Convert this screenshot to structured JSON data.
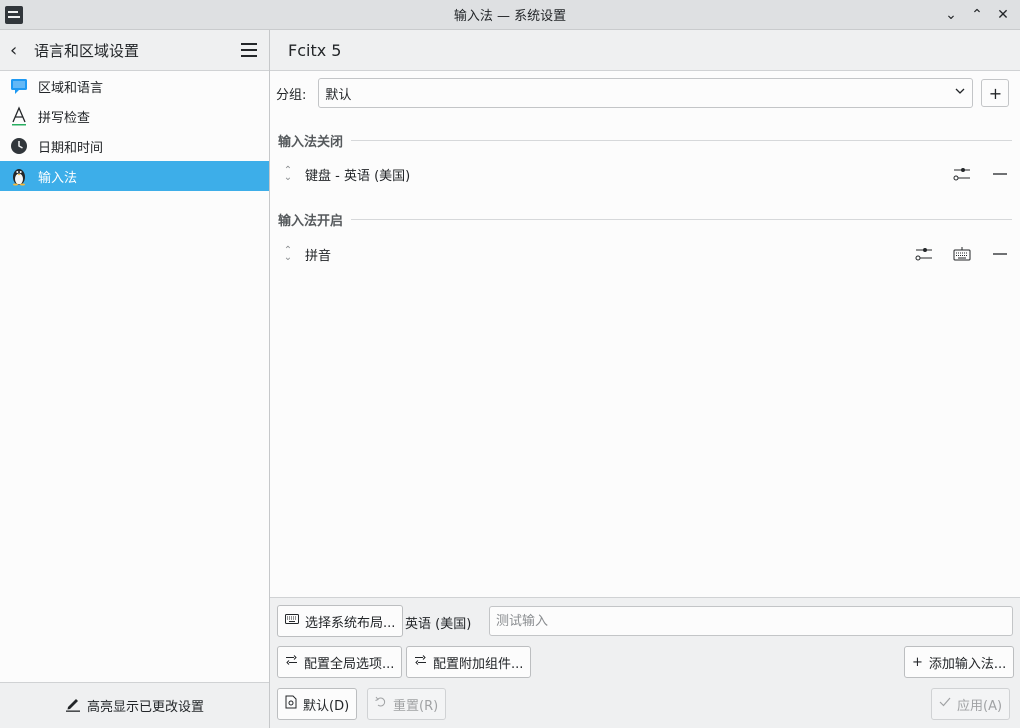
{
  "window": {
    "title": "输入法 — 系统设置"
  },
  "sidebar": {
    "title": "语言和区域设置",
    "items": [
      {
        "label": "区域和语言",
        "icon": "speech-bubble-icon"
      },
      {
        "label": "拼写检查",
        "icon": "letter-a-icon"
      },
      {
        "label": "日期和时间",
        "icon": "clock-icon"
      },
      {
        "label": "输入法",
        "icon": "penguin-icon"
      }
    ],
    "footer_label": "高亮显示已更改设置"
  },
  "main": {
    "title": "Fcitx 5",
    "group_label": "分组:",
    "group_value": "默认",
    "sections": {
      "off": {
        "title": "输入法关闭",
        "items": [
          {
            "name": "键盘 - 英语 (美国)"
          }
        ]
      },
      "on": {
        "title": "输入法开启",
        "items": [
          {
            "name": "拼音"
          }
        ]
      }
    },
    "controls": {
      "select_layout": "选择系统布局...",
      "layout_name": "英语 (美国)",
      "test_placeholder": "测试输入",
      "global_options": "配置全局选项...",
      "addons": "配置附加组件...",
      "add_im": "添加输入法...",
      "defaults": "默认(D)",
      "reset": "重置(R)",
      "apply": "应用(A)"
    }
  },
  "colors": {
    "accent": "#3daee9"
  }
}
